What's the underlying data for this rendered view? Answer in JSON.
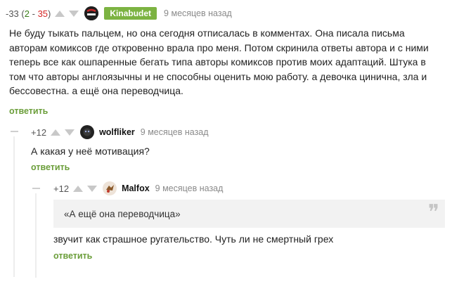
{
  "comments": [
    {
      "rating_total": "-33",
      "rating_open": "(",
      "rating_plus": "2",
      "rating_sep": " - ",
      "rating_minus": "35",
      "rating_close": ")",
      "username": "Kinabudet",
      "time": "9 месяцев назад",
      "text": "Не буду тыкать пальцем, но она сегодня отписалась в комментах. Она писала письма авторам комиксов где откровенно врала про меня. Потом скринила ответы автора и с ними теперь все как ошпаренные бегать типа авторы комиксов против моих адаптаций. Штука в том что авторы англоязычны и не способны оценить мою работу. а девочка цинична, зла и бессовестна. а ещё она переводчица.",
      "reply_label": "ответить"
    },
    {
      "rating": "+12",
      "username": "wolfliker",
      "time": "9 месяцев назад",
      "text": "А какая у неё мотивация?",
      "reply_label": "ответить"
    },
    {
      "rating": "+12",
      "username": "Malfox",
      "time": "9 месяцев назад",
      "quote": "«А ещё она переводчица»",
      "quote_mark": "❞",
      "text": "звучит как страшное ругательство. Чуть ли не смертный грех",
      "reply_label": "ответить"
    }
  ],
  "colors": {
    "accent_green": "#6b9e3a",
    "badge_green": "#7cb342",
    "negative_red": "#d42626",
    "muted_gray": "#8a8a8a"
  },
  "icons": [
    "vote-up-icon",
    "vote-down-icon",
    "collapse-icon",
    "quote-icon"
  ]
}
